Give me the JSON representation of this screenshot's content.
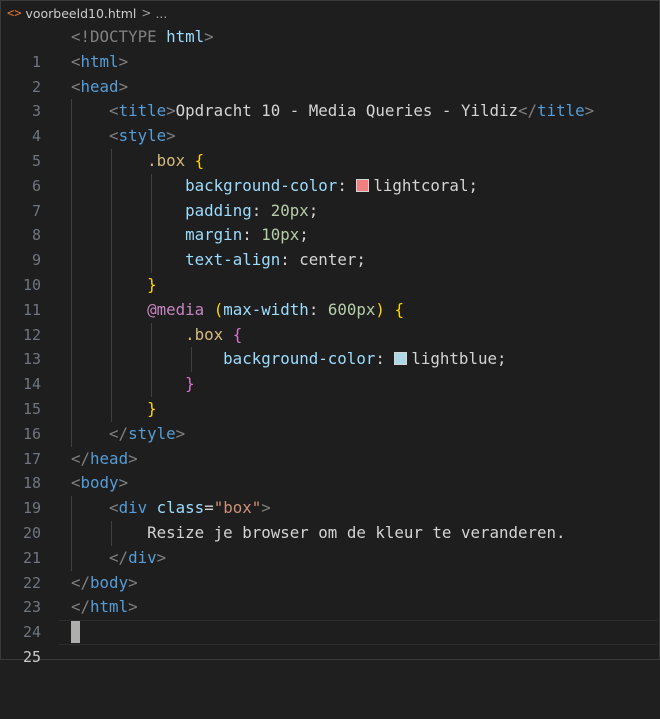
{
  "breadcrumb": {
    "icon": "html-file-icon",
    "file_name": "voorbeeld10.html",
    "separator": ">",
    "more": "..."
  },
  "colors": {
    "background": "#1e1e1e",
    "swatch_lightcoral": "#f08080",
    "swatch_lightblue": "#add8e6"
  },
  "editor": {
    "active_line": 25,
    "lines": [
      {
        "n": "1"
      },
      {
        "n": "2"
      },
      {
        "n": "3"
      },
      {
        "n": "4"
      },
      {
        "n": "5"
      },
      {
        "n": "6"
      },
      {
        "n": "7"
      },
      {
        "n": "8"
      },
      {
        "n": "9"
      },
      {
        "n": "10"
      },
      {
        "n": "11"
      },
      {
        "n": "12"
      },
      {
        "n": "13"
      },
      {
        "n": "14"
      },
      {
        "n": "15"
      },
      {
        "n": "16"
      },
      {
        "n": "17"
      },
      {
        "n": "18"
      },
      {
        "n": "19"
      },
      {
        "n": "20"
      },
      {
        "n": "21"
      },
      {
        "n": "22"
      },
      {
        "n": "23"
      },
      {
        "n": "24"
      },
      {
        "n": "25"
      }
    ],
    "tokens": {
      "doctype_open": "<!DOCTYPE",
      "doctype_name": "html",
      "lt": "<",
      "lt_close": "</",
      "gt": ">",
      "tag_html": "html",
      "tag_head": "head",
      "tag_title": "title",
      "tag_style": "style",
      "tag_body": "body",
      "tag_div": "div",
      "title_text": "Opdracht 10 - Media Queries - Yildiz",
      "sel_box": ".box",
      "brace_open": "{",
      "brace_close": "}",
      "prop_bg": "background-color",
      "prop_padding": "padding",
      "prop_margin": "margin",
      "prop_text_align": "text-align",
      "colon": ":",
      "semicolon": ";",
      "val_lightcoral": "lightcoral",
      "val_20": "20px",
      "val_10": "10px",
      "val_center": "center",
      "at_media": "@media",
      "paren_open": "(",
      "paren_close": ")",
      "prop_max_width": "max-width",
      "val_600": "600px",
      "val_lightblue": "lightblue",
      "attr_class": "class",
      "eq": "=",
      "str_box": "\"box\"",
      "body_text": "Resize je browser om de kleur te veranderen."
    }
  }
}
